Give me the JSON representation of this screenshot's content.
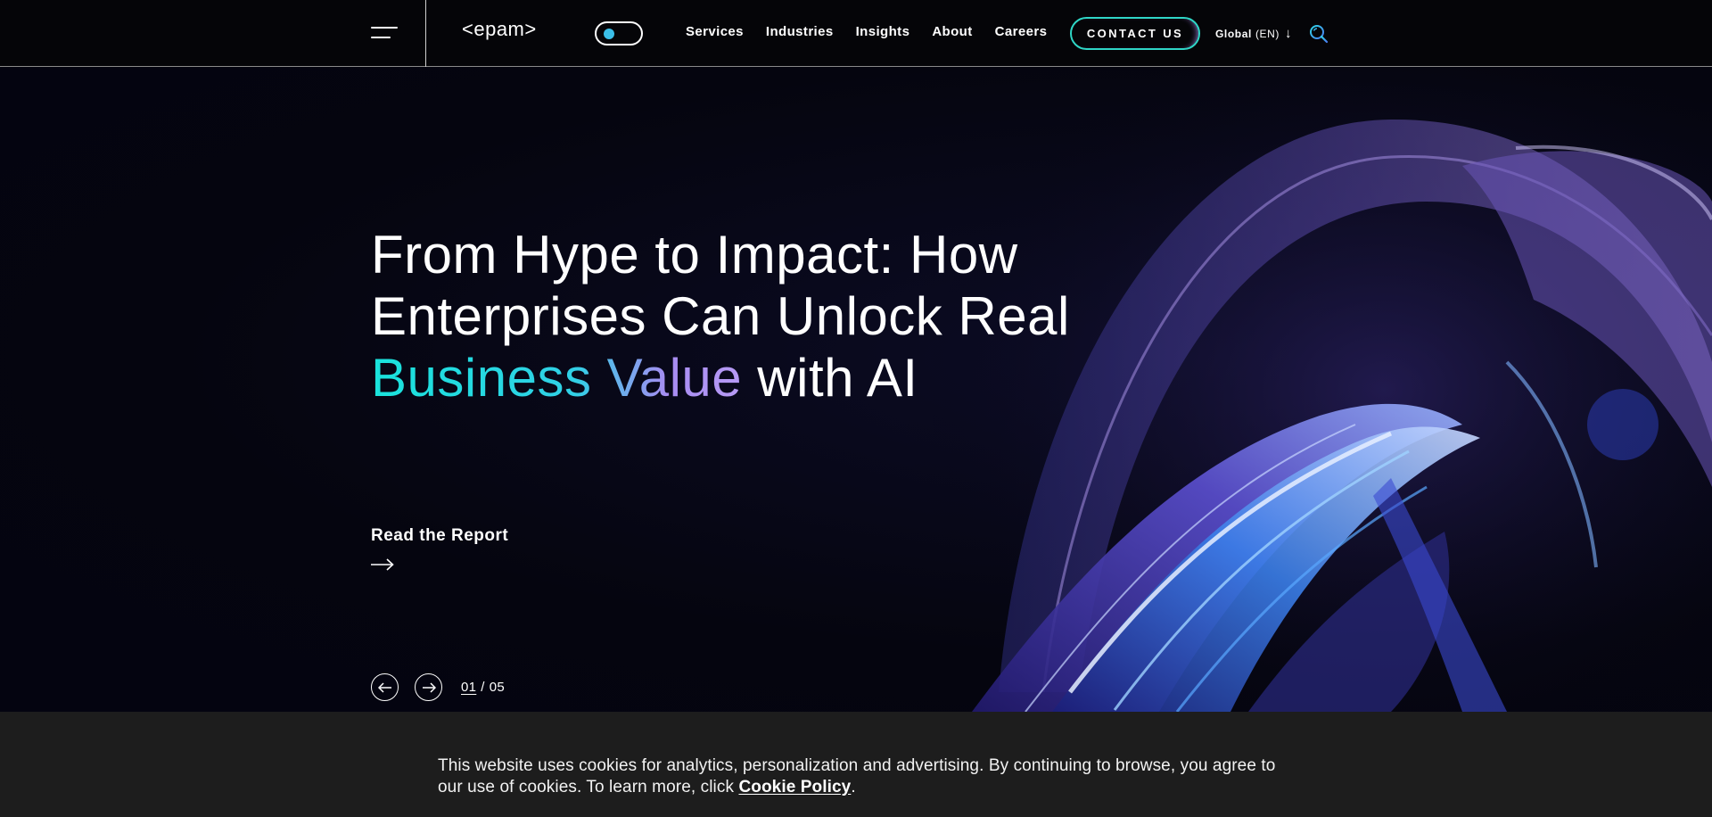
{
  "header": {
    "logo_text": "<epam>",
    "nav": [
      {
        "label": "Services"
      },
      {
        "label": "Industries"
      },
      {
        "label": "Insights"
      },
      {
        "label": "About"
      },
      {
        "label": "Careers"
      }
    ],
    "contact_label": "CONTACT US",
    "lang_label": "Global",
    "lang_code": "(EN)",
    "icons": [
      "menu-icon",
      "theme-toggle",
      "arrow-down-icon",
      "search-icon"
    ]
  },
  "hero": {
    "headline_line1": "From Hype to Impact: How",
    "headline_line2": "Enterprises Can Unlock Real",
    "headline_accent": "Business Value",
    "headline_tail": " with AI",
    "cta_label": "Read the Report",
    "slide_current": "01",
    "slide_separator": "/",
    "slide_total": "05"
  },
  "cookie_banner": {
    "text": "This website uses cookies for analytics, personalization and advertising. By continuing to browse, you agree to our use of cookies. To learn more, click ",
    "link_label": "Cookie Policy",
    "end": "."
  },
  "colors": {
    "accent_teal": "#19e3dc",
    "accent_violet": "#a78cf2",
    "background": "#05050f",
    "banner": "#1d1d1d"
  }
}
